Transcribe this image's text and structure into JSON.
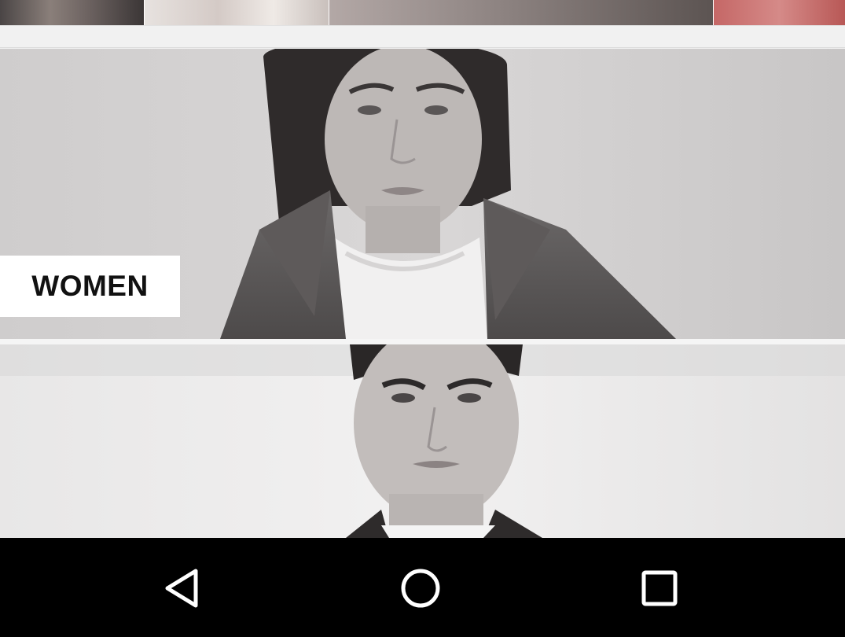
{
  "thumbnails": [
    {
      "name": "thumbnail-1"
    },
    {
      "name": "thumbnail-2"
    },
    {
      "name": "thumbnail-3"
    },
    {
      "name": "thumbnail-4"
    }
  ],
  "categories": [
    {
      "label": "WOMEN"
    },
    {
      "label": ""
    }
  ],
  "navbar": {
    "back_icon": "triangle-back-icon",
    "home_icon": "circle-home-icon",
    "recents_icon": "square-recents-icon"
  },
  "colors": {
    "navbar_bg": "#000000",
    "label_bg": "#ffffff",
    "label_text": "#111111"
  }
}
